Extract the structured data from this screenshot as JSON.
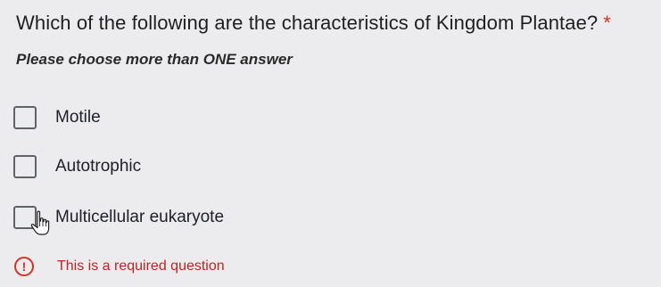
{
  "question": {
    "text": "Which of the following are the characteristics of Kingdom Plantae?",
    "required_marker": "*"
  },
  "instruction": "Please choose more than ONE answer",
  "options": [
    {
      "label": "Motile",
      "checked": false
    },
    {
      "label": "Autotrophic",
      "checked": false
    },
    {
      "label": "Multicellular eukaryote",
      "checked": false
    }
  ],
  "error": {
    "icon": "exclamation-circle-icon",
    "text": "This is a required question"
  },
  "colors": {
    "background": "#ececee",
    "error": "#d93025",
    "checkbox_border": "#5f6368"
  }
}
